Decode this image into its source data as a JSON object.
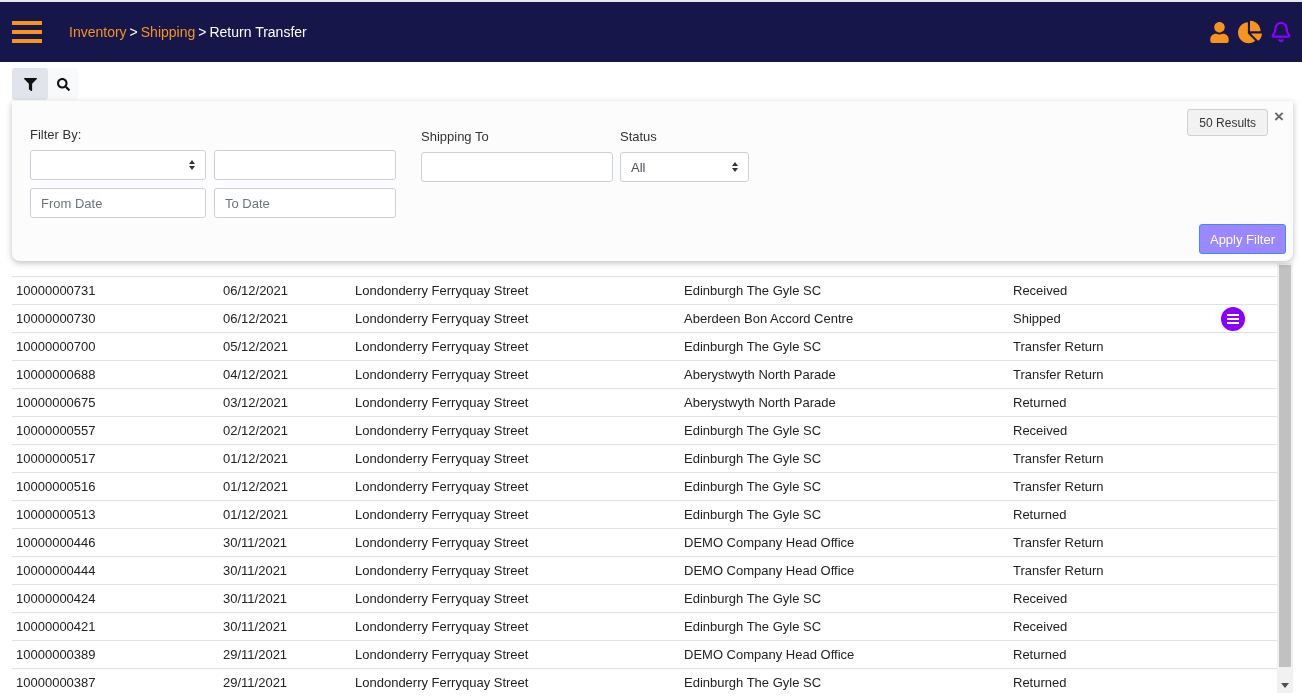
{
  "header": {
    "breadcrumb": [
      {
        "kind": "link",
        "label": "Inventory"
      },
      {
        "kind": "separator",
        "label": ">"
      },
      {
        "kind": "link",
        "label": "Shipping"
      },
      {
        "kind": "separator",
        "label": ">"
      },
      {
        "kind": "current",
        "label": "Return Transfer"
      }
    ]
  },
  "toolbar": [
    {
      "kind": "filter",
      "selected": true
    },
    {
      "kind": "search",
      "selected": false
    }
  ],
  "filter_panel": {
    "filter_by_label": "Filter By:",
    "from_date": {
      "placeholder": "From Date"
    },
    "to_date": {
      "placeholder": "To Date"
    },
    "shipping_to_label": "Shipping To",
    "status": {
      "label": "Status",
      "value": "All"
    },
    "results": "50 Results",
    "close": "×",
    "apply": "Apply Filter"
  },
  "rows": [
    {
      "cells": [
        "10000000731",
        "06/12/2021",
        "Londonderry Ferryquay Street",
        "Edinburgh The Gyle SC",
        "Received"
      ],
      "menu": false
    },
    {
      "cells": [
        "10000000730",
        "06/12/2021",
        "Londonderry Ferryquay Street",
        "Aberdeen Bon Accord Centre",
        "Shipped"
      ],
      "menu": true
    },
    {
      "cells": [
        "10000000700",
        "05/12/2021",
        "Londonderry Ferryquay Street",
        "Edinburgh The Gyle SC",
        "Transfer Return"
      ],
      "menu": false
    },
    {
      "cells": [
        "10000000688",
        "04/12/2021",
        "Londonderry Ferryquay Street",
        "Aberystwyth North Parade",
        "Transfer Return"
      ],
      "menu": false
    },
    {
      "cells": [
        "10000000675",
        "03/12/2021",
        "Londonderry Ferryquay Street",
        "Aberystwyth North Parade",
        "Returned"
      ],
      "menu": false
    },
    {
      "cells": [
        "10000000557",
        "02/12/2021",
        "Londonderry Ferryquay Street",
        "Edinburgh The Gyle SC",
        "Received"
      ],
      "menu": false
    },
    {
      "cells": [
        "10000000517",
        "01/12/2021",
        "Londonderry Ferryquay Street",
        "Edinburgh The Gyle SC",
        "Transfer Return"
      ],
      "menu": false
    },
    {
      "cells": [
        "10000000516",
        "01/12/2021",
        "Londonderry Ferryquay Street",
        "Edinburgh The Gyle SC",
        "Transfer Return"
      ],
      "menu": false
    },
    {
      "cells": [
        "10000000513",
        "01/12/2021",
        "Londonderry Ferryquay Street",
        "Edinburgh The Gyle SC",
        "Returned"
      ],
      "menu": false
    },
    {
      "cells": [
        "10000000446",
        "30/11/2021",
        "Londonderry Ferryquay Street",
        "DEMO Company Head Office",
        "Transfer Return"
      ],
      "menu": false
    },
    {
      "cells": [
        "10000000444",
        "30/11/2021",
        "Londonderry Ferryquay Street",
        "DEMO Company Head Office",
        "Transfer Return"
      ],
      "menu": false
    },
    {
      "cells": [
        "10000000424",
        "30/11/2021",
        "Londonderry Ferryquay Street",
        "Edinburgh The Gyle SC",
        "Received"
      ],
      "menu": false
    },
    {
      "cells": [
        "10000000421",
        "30/11/2021",
        "Londonderry Ferryquay Street",
        "Edinburgh The Gyle SC",
        "Received"
      ],
      "menu": false
    },
    {
      "cells": [
        "10000000389",
        "29/11/2021",
        "Londonderry Ferryquay Street",
        "DEMO Company Head Office",
        "Returned"
      ],
      "menu": false
    },
    {
      "cells": [
        "10000000387",
        "29/11/2021",
        "Londonderry Ferryquay Street",
        "Edinburgh The Gyle SC",
        "Returned"
      ],
      "menu": false
    }
  ]
}
